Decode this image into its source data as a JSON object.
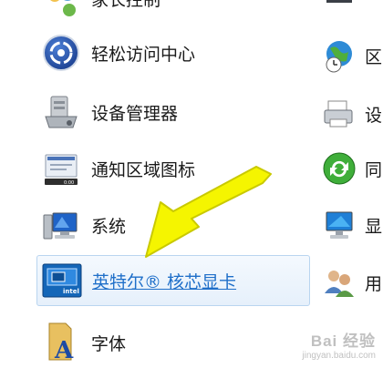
{
  "items": [
    {
      "label": "家长控制",
      "icon": "parental-controls-icon"
    },
    {
      "label": "轻松访问中心",
      "icon": "ease-of-access-icon"
    },
    {
      "label": "设备管理器",
      "icon": "device-manager-icon"
    },
    {
      "label": "通知区域图标",
      "icon": "notification-area-icon"
    },
    {
      "label": "系统",
      "icon": "system-icon"
    },
    {
      "label": "英特尔® 核芯显卡",
      "icon": "intel-graphics-icon"
    },
    {
      "label": "字体",
      "icon": "fonts-icon"
    }
  ],
  "right_items": [
    {
      "label": "区",
      "icon": "region-globe-icon"
    },
    {
      "label": "设",
      "icon": "devices-printers-icon"
    },
    {
      "label": "同",
      "icon": "sync-center-icon"
    },
    {
      "label": "显",
      "icon": "display-icon"
    },
    {
      "label": "用",
      "icon": "user-accounts-icon"
    }
  ],
  "watermark": {
    "brand": "Bai 经验",
    "site": "jingyan.baidu.com"
  }
}
